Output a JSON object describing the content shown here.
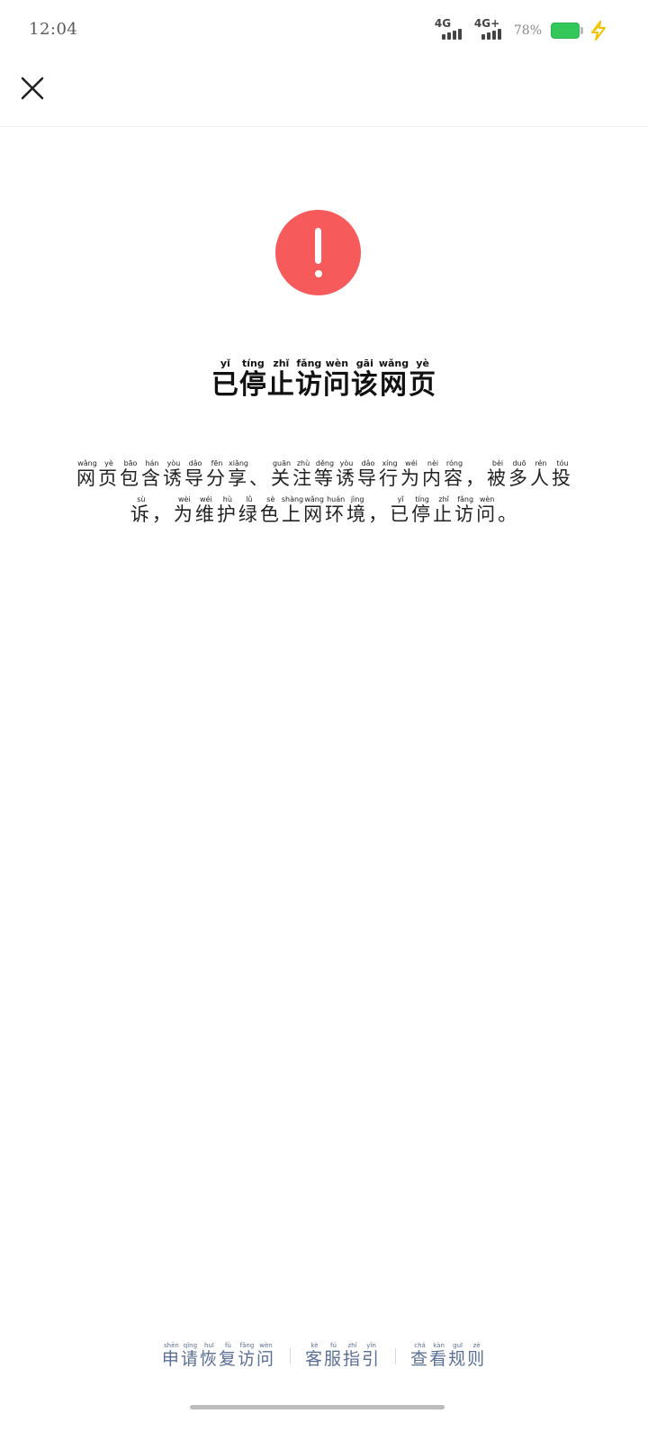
{
  "status_bar": {
    "time": "12:04",
    "network1_label": "4G",
    "network2_label": "4G+",
    "battery_percent": "78%",
    "battery_level": 78,
    "battery_color": "#34c759",
    "charging_icon": "lightning-icon",
    "charging_color": "#f2c200"
  },
  "header": {
    "close_icon": "close-icon"
  },
  "warning": {
    "icon": "exclamation-circle-icon",
    "color": "#f75a5a",
    "title_chars": [
      {
        "c": "已",
        "p": "yǐ"
      },
      {
        "c": "停",
        "p": "tíng"
      },
      {
        "c": "止",
        "p": "zhǐ"
      },
      {
        "c": "访",
        "p": "fǎng"
      },
      {
        "c": "问",
        "p": "wèn"
      },
      {
        "c": "该",
        "p": "gāi"
      },
      {
        "c": "网",
        "p": "wǎng"
      },
      {
        "c": "页",
        "p": "yè"
      }
    ],
    "description_chars": [
      {
        "c": "网",
        "p": "wǎng"
      },
      {
        "c": "页",
        "p": "yè"
      },
      {
        "c": "包",
        "p": "bāo"
      },
      {
        "c": "含",
        "p": "hán"
      },
      {
        "c": "诱",
        "p": "yòu"
      },
      {
        "c": "导",
        "p": "dǎo"
      },
      {
        "c": "分",
        "p": "fēn"
      },
      {
        "c": "享",
        "p": "xiǎng"
      },
      {
        "c": "、",
        "p": ""
      },
      {
        "c": "关",
        "p": "guān"
      },
      {
        "c": "注",
        "p": "zhù"
      },
      {
        "c": "等",
        "p": "děng"
      },
      {
        "c": "诱",
        "p": "yòu"
      },
      {
        "c": "导",
        "p": "dǎo"
      },
      {
        "c": "行",
        "p": "xíng"
      },
      {
        "c": "为",
        "p": "wéi"
      },
      {
        "c": "内",
        "p": "nèi"
      },
      {
        "c": "容",
        "p": "róng"
      },
      {
        "c": "，",
        "p": ""
      },
      {
        "c": "被",
        "p": "bèi"
      },
      {
        "c": "多",
        "p": "duō"
      },
      {
        "c": "人",
        "p": "rén"
      },
      {
        "c": "投",
        "p": "tóu"
      },
      {
        "c": "诉",
        "p": "sù"
      },
      {
        "c": "，",
        "p": ""
      },
      {
        "c": "为",
        "p": "wèi"
      },
      {
        "c": "维",
        "p": "wéi"
      },
      {
        "c": "护",
        "p": "hù"
      },
      {
        "c": "绿",
        "p": "lǜ"
      },
      {
        "c": "色",
        "p": "sè"
      },
      {
        "c": "上",
        "p": "shàng"
      },
      {
        "c": "网",
        "p": "wǎng"
      },
      {
        "c": "环",
        "p": "huán"
      },
      {
        "c": "境",
        "p": "jìng"
      },
      {
        "c": "，",
        "p": ""
      },
      {
        "c": "已",
        "p": "yǐ"
      },
      {
        "c": "停",
        "p": "tíng"
      },
      {
        "c": "止",
        "p": "zhǐ"
      },
      {
        "c": "访",
        "p": "fǎng"
      },
      {
        "c": "问",
        "p": "wèn"
      },
      {
        "c": "。",
        "p": ""
      }
    ]
  },
  "footer": {
    "link_color": "#5a6f96",
    "links": [
      {
        "name": "request-restore-access-link",
        "chars": [
          {
            "c": "申",
            "p": "shēn"
          },
          {
            "c": "请",
            "p": "qǐng"
          },
          {
            "c": "恢",
            "p": "huī"
          },
          {
            "c": "复",
            "p": "fù"
          },
          {
            "c": "访",
            "p": "fǎng"
          },
          {
            "c": "问",
            "p": "wèn"
          }
        ]
      },
      {
        "name": "customer-service-guide-link",
        "chars": [
          {
            "c": "客",
            "p": "kè"
          },
          {
            "c": "服",
            "p": "fú"
          },
          {
            "c": "指",
            "p": "zhǐ"
          },
          {
            "c": "引",
            "p": "yǐn"
          }
        ]
      },
      {
        "name": "view-rules-link",
        "chars": [
          {
            "c": "查",
            "p": "chá"
          },
          {
            "c": "看",
            "p": "kàn"
          },
          {
            "c": "规",
            "p": "guī"
          },
          {
            "c": "则",
            "p": "zé"
          }
        ]
      }
    ]
  }
}
